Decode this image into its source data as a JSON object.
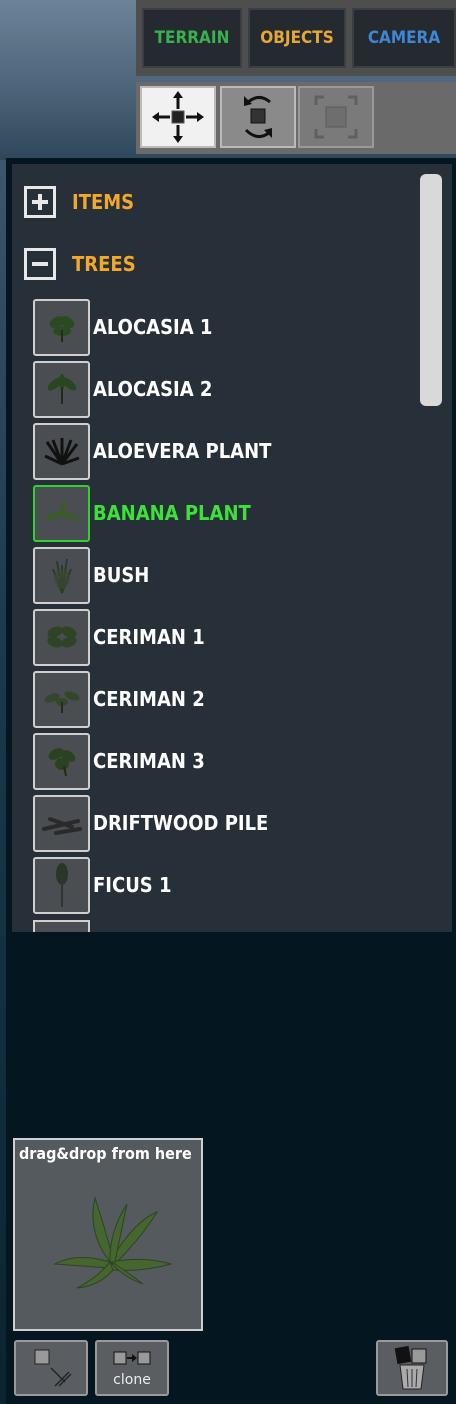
{
  "tabs": {
    "terrain": "TERRAIN",
    "objects": "OBJECTS",
    "camera": "CAMERA",
    "colors": {
      "terrain": "#37b24d",
      "objects": "#e8a735",
      "camera": "#3f86d6"
    }
  },
  "tools": [
    {
      "name": "move",
      "icon": "move-arrows-icon",
      "state": "active"
    },
    {
      "name": "rotate",
      "icon": "rotate-icon",
      "state": "normal"
    },
    {
      "name": "scale",
      "icon": "scale-icon",
      "state": "disabled"
    }
  ],
  "groups": {
    "items": {
      "label": "ITEMS",
      "icon": "plus-icon",
      "expanded": false
    },
    "trees": {
      "label": "TREES",
      "icon": "minus-icon",
      "expanded": true
    }
  },
  "tree_items": [
    {
      "label": "ALOCASIA 1",
      "thumb_icon": "plant-thumb-icon"
    },
    {
      "label": "ALOCASIA 2",
      "thumb_icon": "plant-thumb-icon"
    },
    {
      "label": "ALOEVERA PLANT",
      "thumb_icon": "plant-thumb-icon"
    },
    {
      "label": "BANANA PLANT",
      "thumb_icon": "plant-thumb-icon",
      "selected": true
    },
    {
      "label": "BUSH",
      "thumb_icon": "plant-thumb-icon"
    },
    {
      "label": "CERIMAN 1",
      "thumb_icon": "plant-thumb-icon"
    },
    {
      "label": "CERIMAN 2",
      "thumb_icon": "plant-thumb-icon"
    },
    {
      "label": "CERIMAN 3",
      "thumb_icon": "plant-thumb-icon"
    },
    {
      "label": "DRIFTWOOD PILE",
      "thumb_icon": "driftwood-thumb-icon"
    },
    {
      "label": "FICUS 1",
      "thumb_icon": "tree-thumb-icon"
    }
  ],
  "selected_color": "#3ee13a",
  "preview": {
    "caption": "drag&drop from here",
    "icon": "banana-plant-preview-icon"
  },
  "buttons": {
    "drop": {
      "icon": "drop-to-ground-icon"
    },
    "clone": {
      "label": "clone",
      "icon": "clone-icon"
    },
    "delete": {
      "icon": "trash-icon"
    }
  }
}
